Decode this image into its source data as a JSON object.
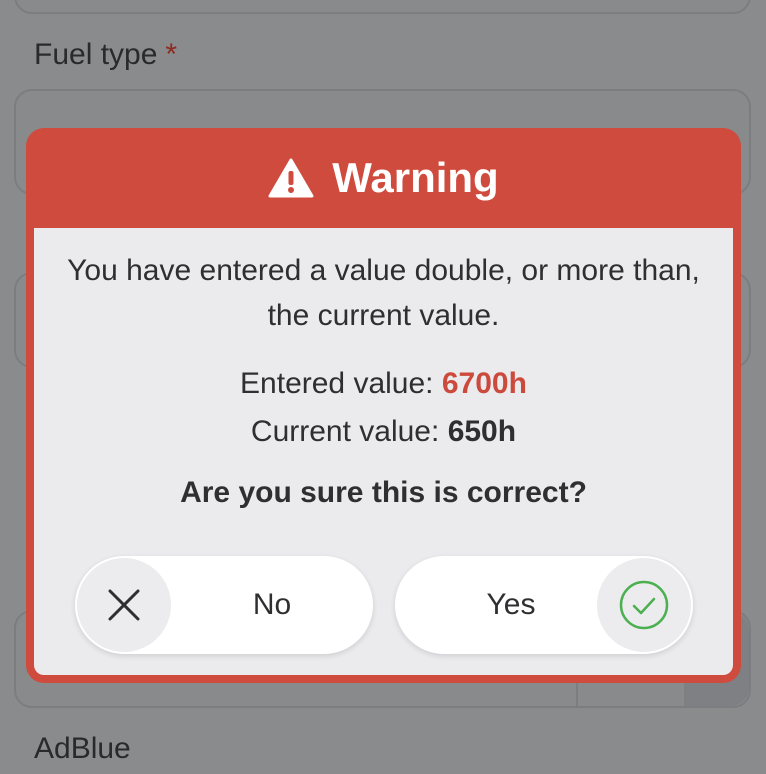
{
  "form": {
    "fuel_type_label": "Fuel type",
    "fuel_type_required": "*",
    "adblue_label": "AdBlue"
  },
  "dialog": {
    "title": "Warning",
    "message": "You have entered a value double, or more than, the current value.",
    "entered_label": "Entered value:",
    "entered_value": "6700h",
    "current_label": "Current value:",
    "current_value": "650h",
    "question": "Are you sure this is correct?",
    "no_label": "No",
    "yes_label": "Yes"
  },
  "icons": {
    "header": "warning-icon",
    "no": "close-icon",
    "yes": "check-circle-icon"
  },
  "colors": {
    "accent": "#cf4b3d",
    "entered_value": "#cc4a3b",
    "confirm": "#4caf50",
    "overlay": "#8a8b8d"
  }
}
